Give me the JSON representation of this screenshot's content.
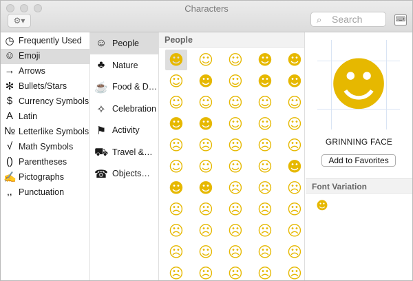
{
  "window": {
    "title": "Characters"
  },
  "toolbar": {
    "gear_icon": "gear-icon",
    "gear_glyph": "⚙▾",
    "search_placeholder": "Search",
    "keyboard_icon": "keyboard-viewer-icon",
    "keyboard_glyph": "⌨"
  },
  "categories": [
    {
      "label": "Frequently Used",
      "icon": "clock-icon",
      "glyph": "◷",
      "selected": false
    },
    {
      "label": "Emoji",
      "icon": "smiley-icon",
      "glyph": "☺",
      "selected": true
    },
    {
      "label": "Arrows",
      "icon": "arrow-icon",
      "glyph": "→",
      "selected": false
    },
    {
      "label": "Bullets/Stars",
      "icon": "asterisk-icon",
      "glyph": "✻",
      "selected": false
    },
    {
      "label": "Currency Symbols",
      "icon": "dollar-icon",
      "glyph": "$",
      "selected": false
    },
    {
      "label": "Latin",
      "icon": "latin-a-icon",
      "glyph": "A",
      "selected": false
    },
    {
      "label": "Letterlike Symbols",
      "icon": "numero-icon",
      "glyph": "№",
      "selected": false
    },
    {
      "label": "Math Symbols",
      "icon": "square-root-icon",
      "glyph": "√",
      "selected": false
    },
    {
      "label": "Parentheses",
      "icon": "parentheses-icon",
      "glyph": "()",
      "selected": false
    },
    {
      "label": "Pictographs",
      "icon": "pictograph-icon",
      "glyph": "✍",
      "selected": false
    },
    {
      "label": "Punctuation",
      "icon": "punctuation-icon",
      "glyph": "‚,",
      "selected": false
    }
  ],
  "subcategories": [
    {
      "label": "People",
      "icon": "smiley-outline-icon",
      "glyph": "☺",
      "selected": true
    },
    {
      "label": "Nature",
      "icon": "tree-icon",
      "glyph": "♣",
      "selected": false
    },
    {
      "label": "Food & D…",
      "icon": "food-icon",
      "glyph": "☕",
      "selected": false
    },
    {
      "label": "Celebration",
      "icon": "confetti-icon",
      "glyph": "✧",
      "selected": false
    },
    {
      "label": "Activity",
      "icon": "runner-icon",
      "glyph": "⚑",
      "selected": false
    },
    {
      "label": "Travel &…",
      "icon": "car-icon",
      "glyph": "⛟",
      "selected": false
    },
    {
      "label": "Objects…",
      "icon": "objects-icon",
      "glyph": "☎",
      "selected": false
    }
  ],
  "grid": {
    "header": "People",
    "emoji": [
      [
        "grinning-face",
        "grimacing-face",
        "face-with-tears-of-joy",
        "smiling-face-open-mouth",
        "smiling-face-open-mouth-smiling-eyes"
      ],
      [
        "smiling-face-open-mouth-cold-sweat",
        "smiling-face-closed-eyes",
        "smiling-face-with-halo",
        "smiling-face-with-horns",
        "imp"
      ],
      [
        "winking-face",
        "smiling-face-smiling-eyes",
        "relieved-face",
        "face-savouring-food",
        "smiling-face-heart-eyes"
      ],
      [
        "heart-eyes-face",
        "face-with-sunglasses",
        "smirking-face",
        "neutral-face",
        "expressionless-face"
      ],
      [
        "unamused-face",
        "face-with-cold-sweat",
        "pensive-face",
        "confused-face",
        "confounded-face"
      ],
      [
        "face-throwing-kiss",
        "kissing-face-with-heart",
        "kissing-face",
        "kissing-face-smiling-eyes",
        "face-with-tongue"
      ],
      [
        "winking-face-with-tongue",
        "tongue-closed-eyes",
        "disappointed-face",
        "worried-face",
        "angry-face"
      ],
      [
        "pouting-face",
        "crying-face",
        "persevering-face",
        "face-with-look-of-triumph",
        "disappointed-relieved-face"
      ],
      [
        "frowning-face",
        "anguished-face",
        "fearful-face",
        "weary-face",
        "sleepy-face"
      ],
      [
        "tired-face",
        "grimacing-face-2",
        "loudly-crying-face",
        "face-open-mouth",
        "hushed-face"
      ],
      [
        "face-screaming-in-fear",
        "astonished-face",
        "flushed-face",
        "dizzy-face",
        "sleeping-face"
      ]
    ],
    "glyphs": [
      [
        "☻",
        "☺",
        "☺",
        "☻",
        "☻"
      ],
      [
        "☺",
        "☻",
        "☺",
        "☻",
        "☻"
      ],
      [
        "☺",
        "☺",
        "☺",
        "☺",
        "☺"
      ],
      [
        "☻",
        "☻",
        "☺",
        "☺",
        "☺"
      ],
      [
        "☹",
        "☹",
        "☹",
        "☹",
        "☹"
      ],
      [
        "☺",
        "☺",
        "☺",
        "☺",
        "☻"
      ],
      [
        "☻",
        "☻",
        "☹",
        "☹",
        "☹"
      ],
      [
        "☹",
        "☹",
        "☹",
        "☹",
        "☹"
      ],
      [
        "☹",
        "☹",
        "☹",
        "☹",
        "☹"
      ],
      [
        "☹",
        "☺",
        "☹",
        "☹",
        "☹"
      ],
      [
        "☹",
        "☹",
        "☹",
        "☹",
        "☹"
      ]
    ],
    "selected_index": 0
  },
  "detail": {
    "preview_icon": "grinning-face",
    "preview_glyph": "☻",
    "name": "GRINNING FACE",
    "favorites_button": "Add to Favorites",
    "font_variation_header": "Font Variation",
    "variation_icon": "grinning-face-small",
    "variation_glyph": "☻"
  },
  "colors": {
    "emoji_yellow": "#e6b800",
    "selection_gray": "#dcdcdc"
  }
}
